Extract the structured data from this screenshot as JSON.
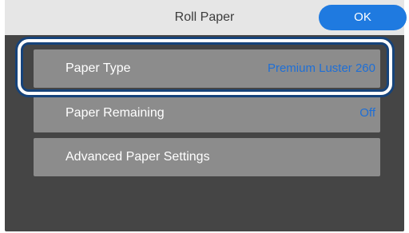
{
  "header": {
    "title": "Roll Paper",
    "ok_label": "OK"
  },
  "menu": {
    "items": [
      {
        "label": "Paper Type",
        "value": "Premium Luster 260",
        "selected": true
      },
      {
        "label": "Paper Remaining",
        "value": "Off",
        "selected": false
      },
      {
        "label": "Advanced Paper Settings",
        "value": "",
        "selected": false
      }
    ]
  },
  "colors": {
    "accent": "#1f7ae0",
    "value_text": "#1f6fd6",
    "item_background": "#8c8c8c",
    "screen_background": "#454545",
    "header_background": "#e6e6e6",
    "focus_ring_outer": "#16437a"
  }
}
